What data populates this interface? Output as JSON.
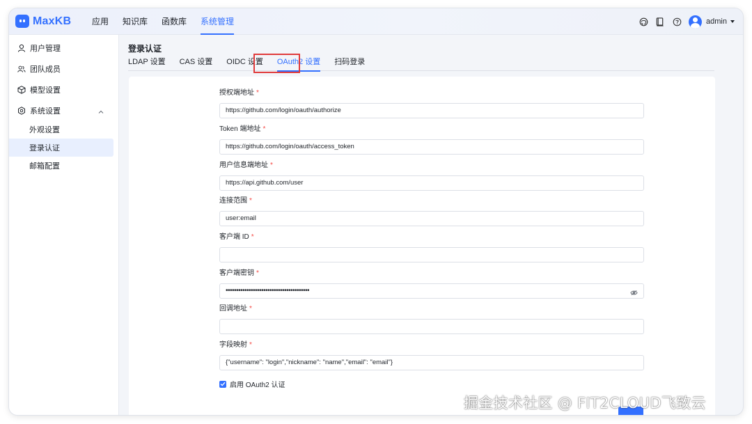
{
  "app": {
    "logo_text": "MaxKB",
    "brand_color": "#3370ff"
  },
  "nav": {
    "items": [
      {
        "label": "应用",
        "active": false
      },
      {
        "label": "知识库",
        "active": false
      },
      {
        "label": "函数库",
        "active": false
      },
      {
        "label": "系统管理",
        "active": true
      }
    ]
  },
  "header_right": {
    "icons": [
      "github-icon",
      "document-icon",
      "help-icon"
    ],
    "user": "admin"
  },
  "sidebar": {
    "items": [
      {
        "label": "用户管理",
        "icon": "user-icon"
      },
      {
        "label": "团队成员",
        "icon": "team-icon"
      },
      {
        "label": "模型设置",
        "icon": "cube-icon"
      },
      {
        "label": "系统设置",
        "icon": "gear-icon",
        "expanded": true
      },
      {
        "label": "外观设置",
        "sub": true
      },
      {
        "label": "登录认证",
        "sub": true,
        "active": true
      },
      {
        "label": "邮箱配置",
        "sub": true
      }
    ]
  },
  "page": {
    "title": "登录认证",
    "tabs": [
      {
        "label": "LDAP 设置",
        "active": false
      },
      {
        "label": "CAS 设置",
        "active": false
      },
      {
        "label": "OIDC 设置",
        "active": false
      },
      {
        "label": "OAuth2 设置",
        "active": true
      },
      {
        "label": "扫码登录",
        "active": false
      }
    ]
  },
  "form": {
    "fields": [
      {
        "label": "授权端地址",
        "value": "https://github.com/login/oauth/authorize"
      },
      {
        "label": "Token 端地址",
        "value": "https://github.com/login/oauth/access_token"
      },
      {
        "label": "用户信息端地址",
        "value": "https://api.github.com/user"
      },
      {
        "label": "连接范围",
        "value": "user:email"
      },
      {
        "label": "客户端 ID",
        "value": ""
      },
      {
        "label": "客户端密钥",
        "value": "••••••••••••••••••••••••••••••••••••••••"
      },
      {
        "label": "回调地址",
        "value": ""
      },
      {
        "label": "字段映射",
        "value": "{\"username\": \"login\",\"nickname\": \"name\",\"email\": \"email\"}"
      }
    ],
    "required_mark": "*",
    "enable_label": "启用 OAuth2 认证",
    "enable_checked": true
  },
  "watermark": "掘金技术社区 @ FIT2CLOUD飞致云"
}
